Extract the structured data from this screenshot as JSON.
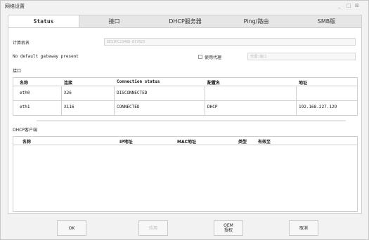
{
  "window": {
    "title": "网络设置",
    "controls": [
      "minimize-icon",
      "maximize-icon",
      "close-icon"
    ],
    "control_glyphs": [
      "_",
      "□",
      "⊠"
    ]
  },
  "tabs": [
    "Status",
    "接口",
    "DHCP服务器",
    "Ping/路由",
    "SMB版"
  ],
  "computer": {
    "label": "计算机名",
    "value": "DESIPC23488-817823"
  },
  "gateway": {
    "text": "No default gateway present",
    "proxy_label": "使用代理",
    "proxy_placeholder": "代理:端口"
  },
  "interfaces": {
    "label": "接口",
    "headers": [
      "名称",
      "连接",
      "Connection status",
      "配置名",
      "地址"
    ],
    "rows": [
      [
        "eth0",
        "X26",
        "DISCONNECTED",
        "",
        ""
      ],
      [
        "eth1",
        "X116",
        "CONNECTED",
        "DHCP",
        "192.168.227.129"
      ]
    ]
  },
  "dhcp": {
    "label": "DHCP客户端",
    "headers": [
      "名称",
      "IP地址",
      "MAC地址",
      "类型",
      "有效至"
    ]
  },
  "buttons": {
    "ok": "OK",
    "apply": "应用",
    "oem_line1": "OEM",
    "oem_line2": "授权",
    "cancel": "取消"
  }
}
